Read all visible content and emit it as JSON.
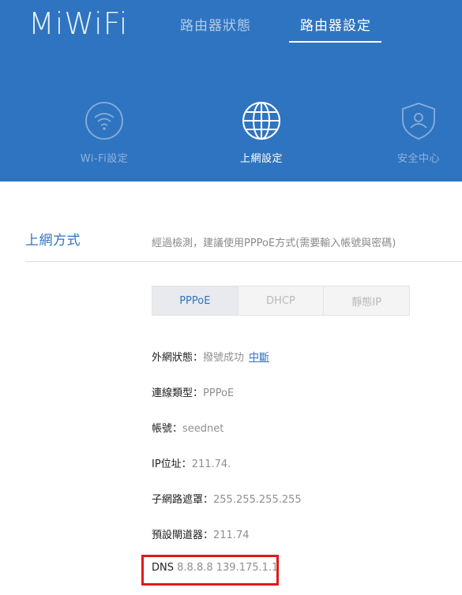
{
  "header": {
    "logo": "MiWiFi",
    "nav": [
      {
        "label": "路由器狀態",
        "active": false
      },
      {
        "label": "路由器設定",
        "active": true
      }
    ],
    "icon_tabs": [
      {
        "label": "Wi-Fi設定",
        "icon": "wifi-icon",
        "active": false
      },
      {
        "label": "上網設定",
        "icon": "globe-icon",
        "active": true
      },
      {
        "label": "安全中心",
        "icon": "shield-user-icon",
        "active": false
      }
    ]
  },
  "section": {
    "title": "上網方式",
    "description": "經過檢測，建議使用PPPoE方式(需要輸入帳號與密碼)"
  },
  "connection_types": [
    "PPPoE",
    "DHCP",
    "靜態IP"
  ],
  "selected_type": "PPPoE",
  "info": {
    "wan_status_label": "外網狀態：",
    "wan_status_value": "撥號成功",
    "wan_status_action": "中斷",
    "conn_type_label": "連線類型：",
    "conn_type_value": "PPPoE",
    "account_label": "帳號：",
    "account_value": "seednet",
    "ip_label": "IP位址：",
    "ip_value": "211.74.",
    "subnet_label": "子網路遮罩：",
    "subnet_value": "255.255.255.255",
    "gateway_label": "預設閘道器：",
    "gateway_value": "211.74",
    "dns_label": "DNS",
    "dns_value": "8.8.8.8 139.175.1.1"
  },
  "colors": {
    "brand_blue": "#2f74c0",
    "highlight_red": "#e11919"
  }
}
